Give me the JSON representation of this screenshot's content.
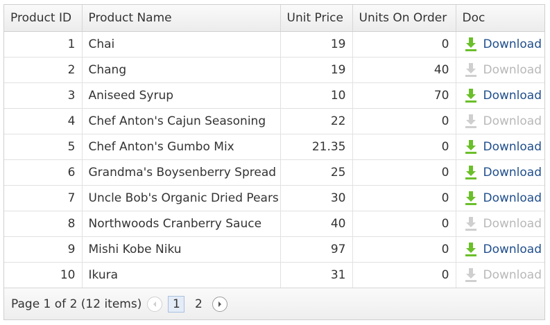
{
  "columns": [
    "Product ID",
    "Product Name",
    "Unit Price",
    "Units On Order",
    "Doc"
  ],
  "rows": [
    {
      "id": "1",
      "name": "Chai",
      "price": "19",
      "on_order": "0",
      "doc": "Download",
      "doc_enabled": true
    },
    {
      "id": "2",
      "name": "Chang",
      "price": "19",
      "on_order": "40",
      "doc": "Download",
      "doc_enabled": false
    },
    {
      "id": "3",
      "name": "Aniseed Syrup",
      "price": "10",
      "on_order": "70",
      "doc": "Download",
      "doc_enabled": true
    },
    {
      "id": "4",
      "name": "Chef Anton's Cajun Seasoning",
      "price": "22",
      "on_order": "0",
      "doc": "Download",
      "doc_enabled": false
    },
    {
      "id": "5",
      "name": "Chef Anton's Gumbo Mix",
      "price": "21.35",
      "on_order": "0",
      "doc": "Download",
      "doc_enabled": true
    },
    {
      "id": "6",
      "name": "Grandma's Boysenberry Spread",
      "price": "25",
      "on_order": "0",
      "doc": "Download",
      "doc_enabled": true
    },
    {
      "id": "7",
      "name": "Uncle Bob's Organic Dried Pears",
      "price": "30",
      "on_order": "0",
      "doc": "Download",
      "doc_enabled": true
    },
    {
      "id": "8",
      "name": "Northwoods Cranberry Sauce",
      "price": "40",
      "on_order": "0",
      "doc": "Download",
      "doc_enabled": false
    },
    {
      "id": "9",
      "name": "Mishi Kobe Niku",
      "price": "97",
      "on_order": "0",
      "doc": "Download",
      "doc_enabled": true
    },
    {
      "id": "10",
      "name": "Ikura",
      "price": "31",
      "on_order": "0",
      "doc": "Download",
      "doc_enabled": false
    }
  ],
  "pager": {
    "summary": "Page 1 of 2 (12 items)",
    "pages": [
      "1",
      "2"
    ],
    "current_page": "1",
    "prev_icon": "chevron-left-icon",
    "next_icon": "chevron-right-icon"
  },
  "colors": {
    "link": "#1f4e8c",
    "link_disabled": "#b8b8b8",
    "download_icon": "#6bbf2a",
    "download_icon_disabled": "#cfcfcf"
  }
}
